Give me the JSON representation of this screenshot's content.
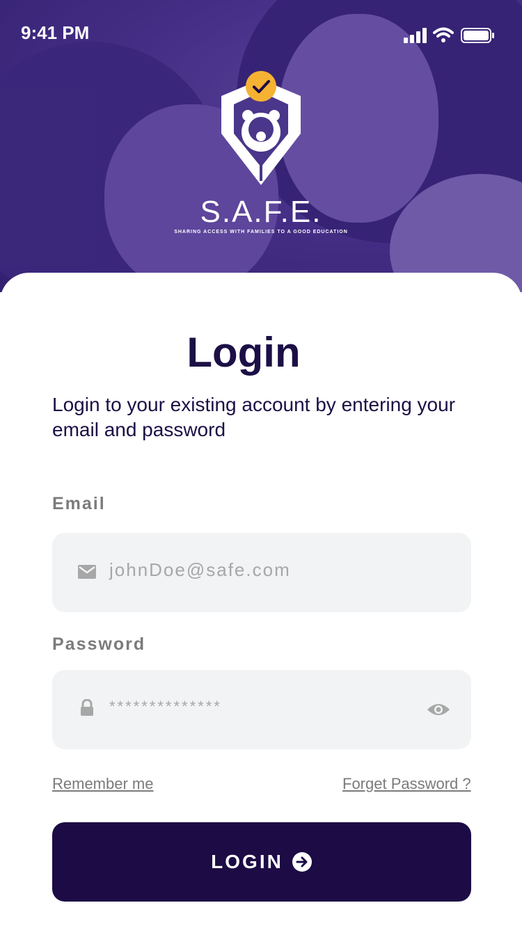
{
  "status_bar": {
    "time": "9:41 PM"
  },
  "brand": {
    "name": "S.A.F.E.",
    "tagline": "SHARING ACCESS WITH FAMILIES TO A GOOD EDUCATION"
  },
  "login": {
    "title": "Login",
    "subtitle": "Login to your existing account by entering your email and password",
    "email": {
      "label": "Email",
      "placeholder": "johnDoe@safe.com"
    },
    "password": {
      "label": "Password",
      "masked_value": "**************"
    },
    "remember_label": "Remember me",
    "forgot_label": "Forget Password ?",
    "button_label": "LOGIN"
  },
  "colors": {
    "brand_dark": "#1c0b45",
    "brand_purple": "#4a368a",
    "accent_yellow": "#f6b233",
    "field_bg": "#f1f3f4"
  },
  "icons": [
    "signal-icon",
    "wifi-icon",
    "battery-icon",
    "shield-logo-icon",
    "checkmark-badge-icon",
    "mail-icon",
    "lock-icon",
    "eye-icon",
    "arrow-right-circle-icon"
  ]
}
